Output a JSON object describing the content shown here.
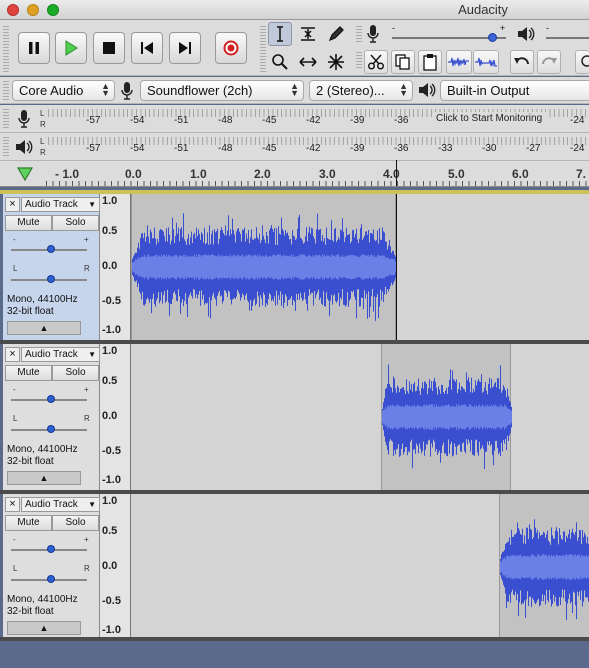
{
  "window": {
    "title": "Audacity"
  },
  "devices": {
    "host": "Core Audio",
    "input": "Soundflower (2ch)",
    "channels": "2 (Stereo)...",
    "output": "Built-in Output"
  },
  "meters": {
    "channel_left": "L",
    "channel_right": "R",
    "record_labels": [
      "-57",
      "-54",
      "-51",
      "-48",
      "-45",
      "-42",
      "-39",
      "-36",
      "-24"
    ],
    "play_labels": [
      "-57",
      "-54",
      "-51",
      "-48",
      "-45",
      "-42",
      "-39",
      "-36",
      "-33",
      "-30",
      "-27",
      "-24"
    ],
    "monitor_hint": "Click to Start Monitoring"
  },
  "ruler": {
    "labels": [
      "- 1.0",
      "0.0",
      "1.0",
      "2.0",
      "3.0",
      "4.0",
      "5.0",
      "6.0",
      "7."
    ]
  },
  "tracks": [
    {
      "name": "Audio Track",
      "mute": "Mute",
      "solo": "Solo",
      "rate": "Mono, 44100Hz",
      "format": "32-bit float"
    },
    {
      "name": "Audio Track",
      "mute": "Mute",
      "solo": "Solo",
      "rate": "Mono, 44100Hz",
      "format": "32-bit float"
    },
    {
      "name": "Audio Track",
      "mute": "Mute",
      "solo": "Solo",
      "rate": "Mono, 44100Hz",
      "format": "32-bit float"
    }
  ],
  "scale": [
    "1.0",
    "0.5",
    "0.0",
    "-0.5",
    "-1.0"
  ],
  "track_controls": {
    "close": "×",
    "dropdown": "▼",
    "collapse": "▲",
    "gain_minus": "-",
    "gain_plus": "+",
    "pan_left": "L",
    "pan_right": "R"
  },
  "volume": {
    "minus": "-",
    "plus": "+"
  },
  "colors": {
    "waveform": "#3a4fd0",
    "waveform_light": "#6a80e6",
    "clip": "#c2c2c2",
    "background": "#d4d4d4",
    "selected_panel": "#c7d5ec"
  }
}
